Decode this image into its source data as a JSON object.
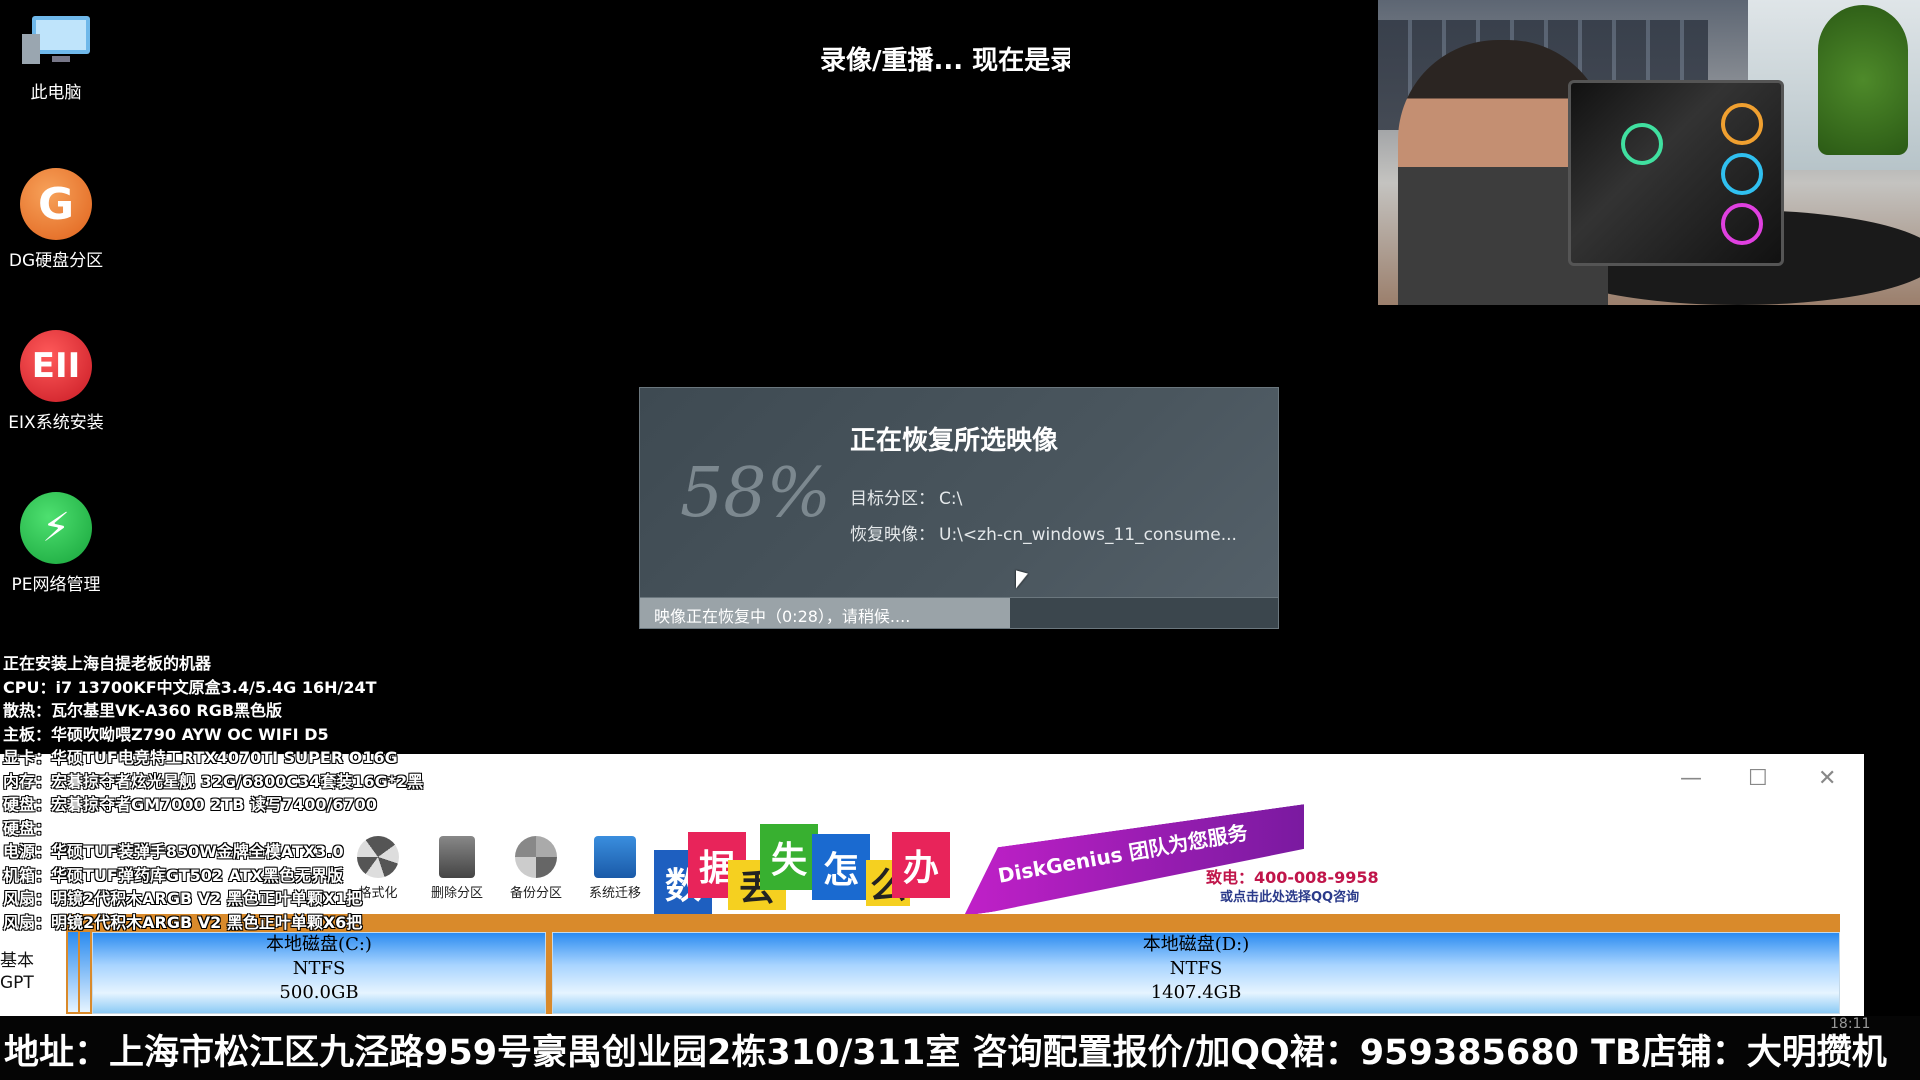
{
  "desktop": {
    "icons": [
      {
        "label": "此电脑",
        "icon": "computer-icon"
      },
      {
        "label": "DG硬盘分区",
        "icon": "diskgenius-icon",
        "glyph": "G"
      },
      {
        "label": "EIX系统安装",
        "icon": "eix-icon",
        "glyph": "EII"
      },
      {
        "label": "PE网络管理",
        "icon": "pe-network-icon",
        "glyph": "⚡"
      }
    ]
  },
  "caption_top": "录像/重播... 现在是录",
  "restore_dialog": {
    "percent_text": "58%",
    "progress": 0.58,
    "title": "正在恢复所选映像",
    "target_label": "目标分区：",
    "target_value": "C:\\",
    "image_label": "恢复映像：",
    "image_value": "U:\\<zh-cn_windows_11_consume...",
    "status": "映像正在恢复中（0:28），请稍候...."
  },
  "specs": [
    "正在安装上海自提老板的机器",
    "CPU：i7 13700KF中文原盒3.4/5.4G 16H/24T",
    "散热：瓦尔基里VK-A360 RGB黑色版",
    "主板：华硕吹呦喂Z790 AYW OC WIFI D5",
    "显卡：华硕TUF电竞特工RTX4070TI SUPER O16G",
    "内存：宏碁掠夺者炫光星舰 32G/6800C34套装16G*2黑",
    "硬盘：宏碁掠夺者GM7000 2TB 读写7400/6700",
    "硬盘：",
    "电源：华硕TUF装弹手850W金牌全模ATX3.0",
    "机箱：华硕TUF弹药库GT502 ATX黑色无界版",
    "风扇：明镜2代积木ARGB V2 黑色正叶单颗X1把",
    "风扇：明镜2代积木ARGB V2 黑色正叶单颗X6把"
  ],
  "diskgenius": {
    "window_controls": {
      "minimize": "—",
      "maximize": "☐",
      "close": "✕"
    },
    "toolbar": [
      {
        "label": "格式化",
        "icon": "format-icon"
      },
      {
        "label": "删除分区",
        "icon": "delete-partition-icon"
      },
      {
        "label": "备份分区",
        "icon": "backup-partition-icon"
      },
      {
        "label": "系统迁移",
        "icon": "system-migrate-icon"
      }
    ],
    "ad_chars": [
      "数",
      "据",
      "丢",
      "失",
      "怎",
      "么",
      "办"
    ],
    "promo_text": "DiskGenius 团队为您服务",
    "phone_text": "致电：400-008-9958",
    "qq_text": "或点击此处选择QQ咨询",
    "disk_label_1": "基本",
    "disk_label_2": "GPT",
    "partitions": [
      {
        "name": "本地磁盘(C:)",
        "fs": "NTFS",
        "size": "500.0GB"
      },
      {
        "name": "本地磁盘(D:)",
        "fs": "NTFS",
        "size": "1407.4GB"
      }
    ]
  },
  "ticker": {
    "text": "地址：上海市松江区九泾路959号豪禺创业园2栋310/311室  咨询配置报价/加QQ裙：959385680  TB店铺：大明攒机",
    "clock": "18:11"
  },
  "colors": {
    "dialog_bg": "#44515a",
    "partition_blue": "#2a8bf0",
    "disk_orange": "#d98a2b",
    "promo_purple": "#c020c8"
  }
}
